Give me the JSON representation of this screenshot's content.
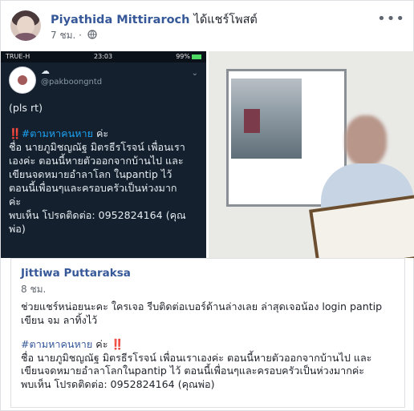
{
  "post": {
    "author": "Piyathida Mittiraroch",
    "action": "ได้แชร์โพสต์",
    "time": "7 ชม.",
    "separator": "·",
    "privacy_icon": "globe-icon",
    "menu_icon": "more-options-icon",
    "menu_glyph": "•••"
  },
  "phone": {
    "carrier": "TRUE-H",
    "time": "23:03",
    "battery": "99%",
    "status_icons": [
      "signal-icon",
      "wifi-icon",
      "alarm-icon",
      "battery-icon"
    ],
    "handle": "@pakboongntd",
    "chevron": "⌄",
    "pls": "(pls rt)",
    "bang": "‼️",
    "hashtag": "#ตามหาคนหาย",
    "hashtag_suffix": " ค่ะ",
    "lines": [
      "ชื่อ นายภูมิชญณัฐ มิตรธีรโรจน์ เพื่อนเรา",
      "เองค่ะ ตอนนี้หายตัวออกจากบ้านไป และ",
      "เขียนจดหมายอำลาโลก ในpantip ไว้",
      "ตอนนี้เพื่อนๆและครอบครัวเป็นห่วงมาก",
      "ค่ะ",
      "พบเห็น โปรดติดต่อ: 0952824164 (คุณ",
      "พ่อ)"
    ]
  },
  "shared": {
    "author": "Jittiwa Puttaraksa",
    "time": "8 ชม.",
    "intro_lines": [
      "ช่วยแชร์หน่อยนะคะ ใครเจอ รีบติดต่อเบอร์ด้านล่างเลย ล่าสุดเจอน้อง login pantip",
      "เขียน จม ลาทิ้งไว้"
    ],
    "hashtag": "#ตามหาคนหาย",
    "hashtag_suffix": " ค่ะ ",
    "bang": "‼️",
    "body_lines": [
      "ชื่อ นายภูมิชญณัฐ มิตรธีรโรจน์ เพื่อนเราเองค่ะ ตอนนี้หายตัวออกจากบ้านไป และ",
      "เขียนจดหมายอำลาโลกในpantip ไว้ ตอนนี้เพื่อนๆและครอบครัวเป็นห่วงมากค่ะ",
      "พบเห็น โปรดติดต่อ: 0952824164 (คุณพ่อ)"
    ]
  },
  "colors": {
    "link": "#365899",
    "text": "#1d2129",
    "meta": "#616770",
    "twitter_bg": "#14202d",
    "twitter_blue": "#1da1f2",
    "alert_red": "#e0245e"
  }
}
